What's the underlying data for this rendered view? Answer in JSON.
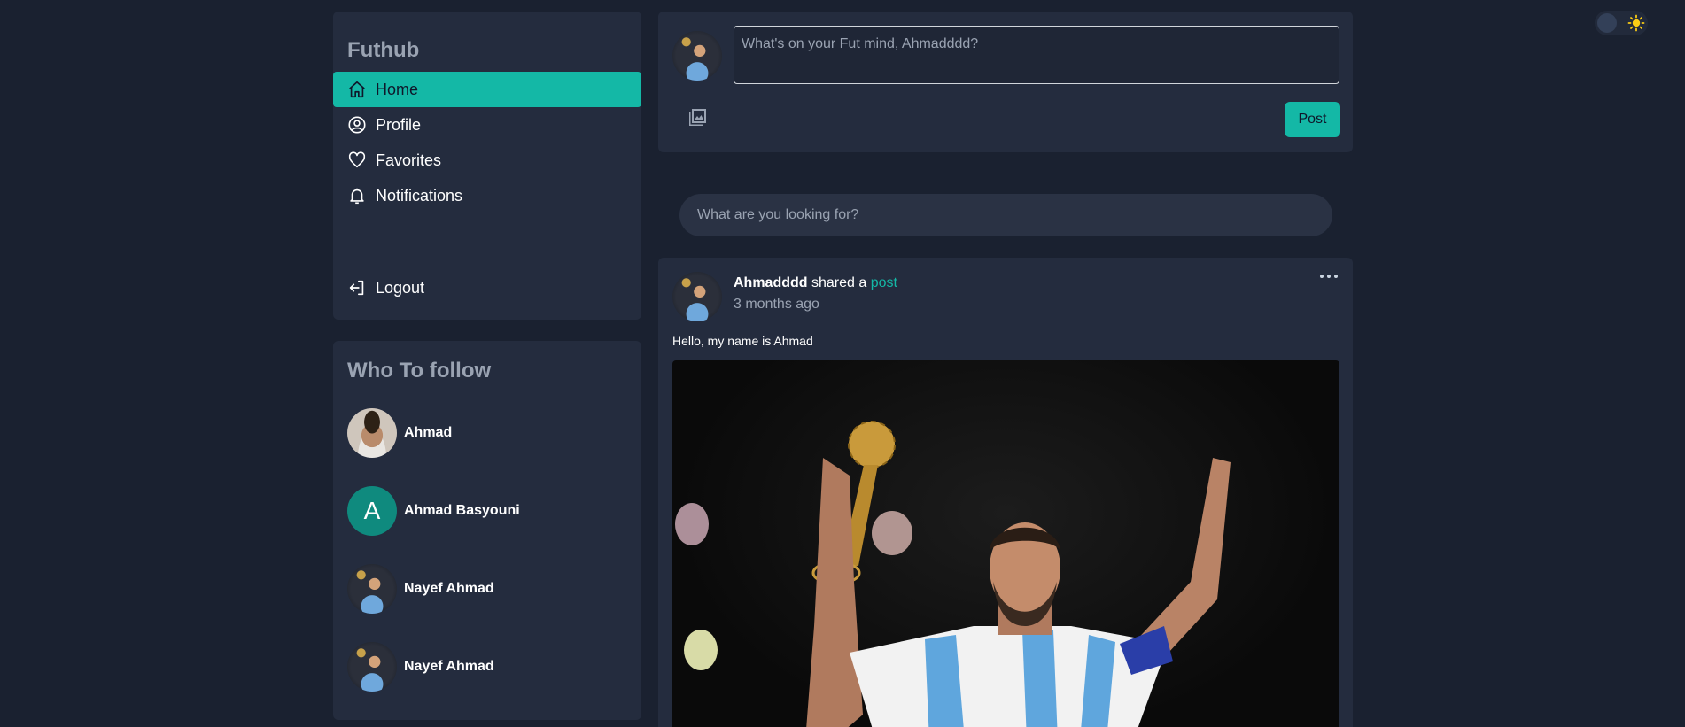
{
  "app": {
    "brand": "Futhub"
  },
  "nav": {
    "items": [
      {
        "label": "Home",
        "icon": "home-icon",
        "active": true
      },
      {
        "label": "Profile",
        "icon": "user-circle-icon",
        "active": false
      },
      {
        "label": "Favorites",
        "icon": "heart-icon",
        "active": false
      },
      {
        "label": "Notifications",
        "icon": "bell-icon",
        "active": false
      }
    ],
    "logout_label": "Logout"
  },
  "follow": {
    "title": "Who To follow",
    "users": [
      {
        "name": "Ahmad",
        "avatar": "photo"
      },
      {
        "name": "Ahmad Basyouni",
        "avatar": "letter",
        "initial": "A"
      },
      {
        "name": "Nayef Ahmad",
        "avatar": "photo"
      },
      {
        "name": "Nayef Ahmad",
        "avatar": "photo"
      }
    ]
  },
  "composer": {
    "placeholder": "What's on your Fut mind, Ahmadddd?",
    "post_label": "Post",
    "image_icon": "image-icon"
  },
  "search": {
    "placeholder": "What are you looking for?"
  },
  "post": {
    "author": "Ahmadddd",
    "action": "shared a",
    "link_text": "post",
    "time": "3 months ago",
    "caption": "Hello, my name is Ahmad",
    "menu_icon": "more-horizontal-icon"
  },
  "theme": {
    "mode": "dark",
    "icons": [
      "moon-knob",
      "sun-icon"
    ]
  },
  "colors": {
    "background": "#1a2130",
    "card": "#242c3e",
    "accent": "#14b8a6",
    "muted_text": "#9aa3b2"
  }
}
